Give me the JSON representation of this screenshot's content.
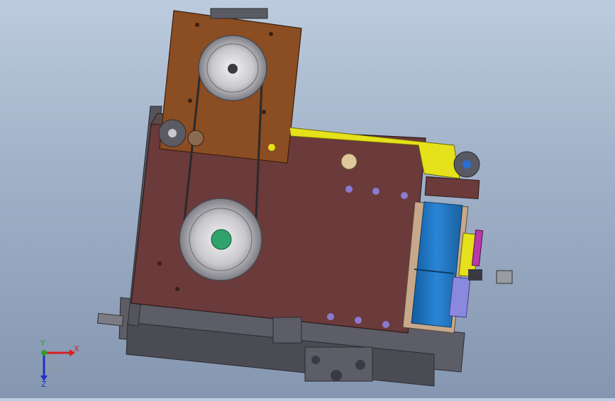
{
  "viewport": {
    "background_top": "#bccbdd",
    "background_bottom": "#8596b1"
  },
  "model": {
    "colors": {
      "base_plate": "#6b3a3a",
      "upper_plate": "#8b4d22",
      "frame": "#56575f",
      "pulley": "#c9c9cd",
      "hub": "#2fa36b",
      "motor_blue": "#1f73c0",
      "yellow_arm": "#e5e11a",
      "belt": "#2b2b2b"
    }
  },
  "triad": {
    "x_label": "X",
    "y_label": "Y",
    "z_label": "Z",
    "x_color": "#d62020",
    "y_color": "#2aa02a",
    "z_color": "#2030c8"
  }
}
